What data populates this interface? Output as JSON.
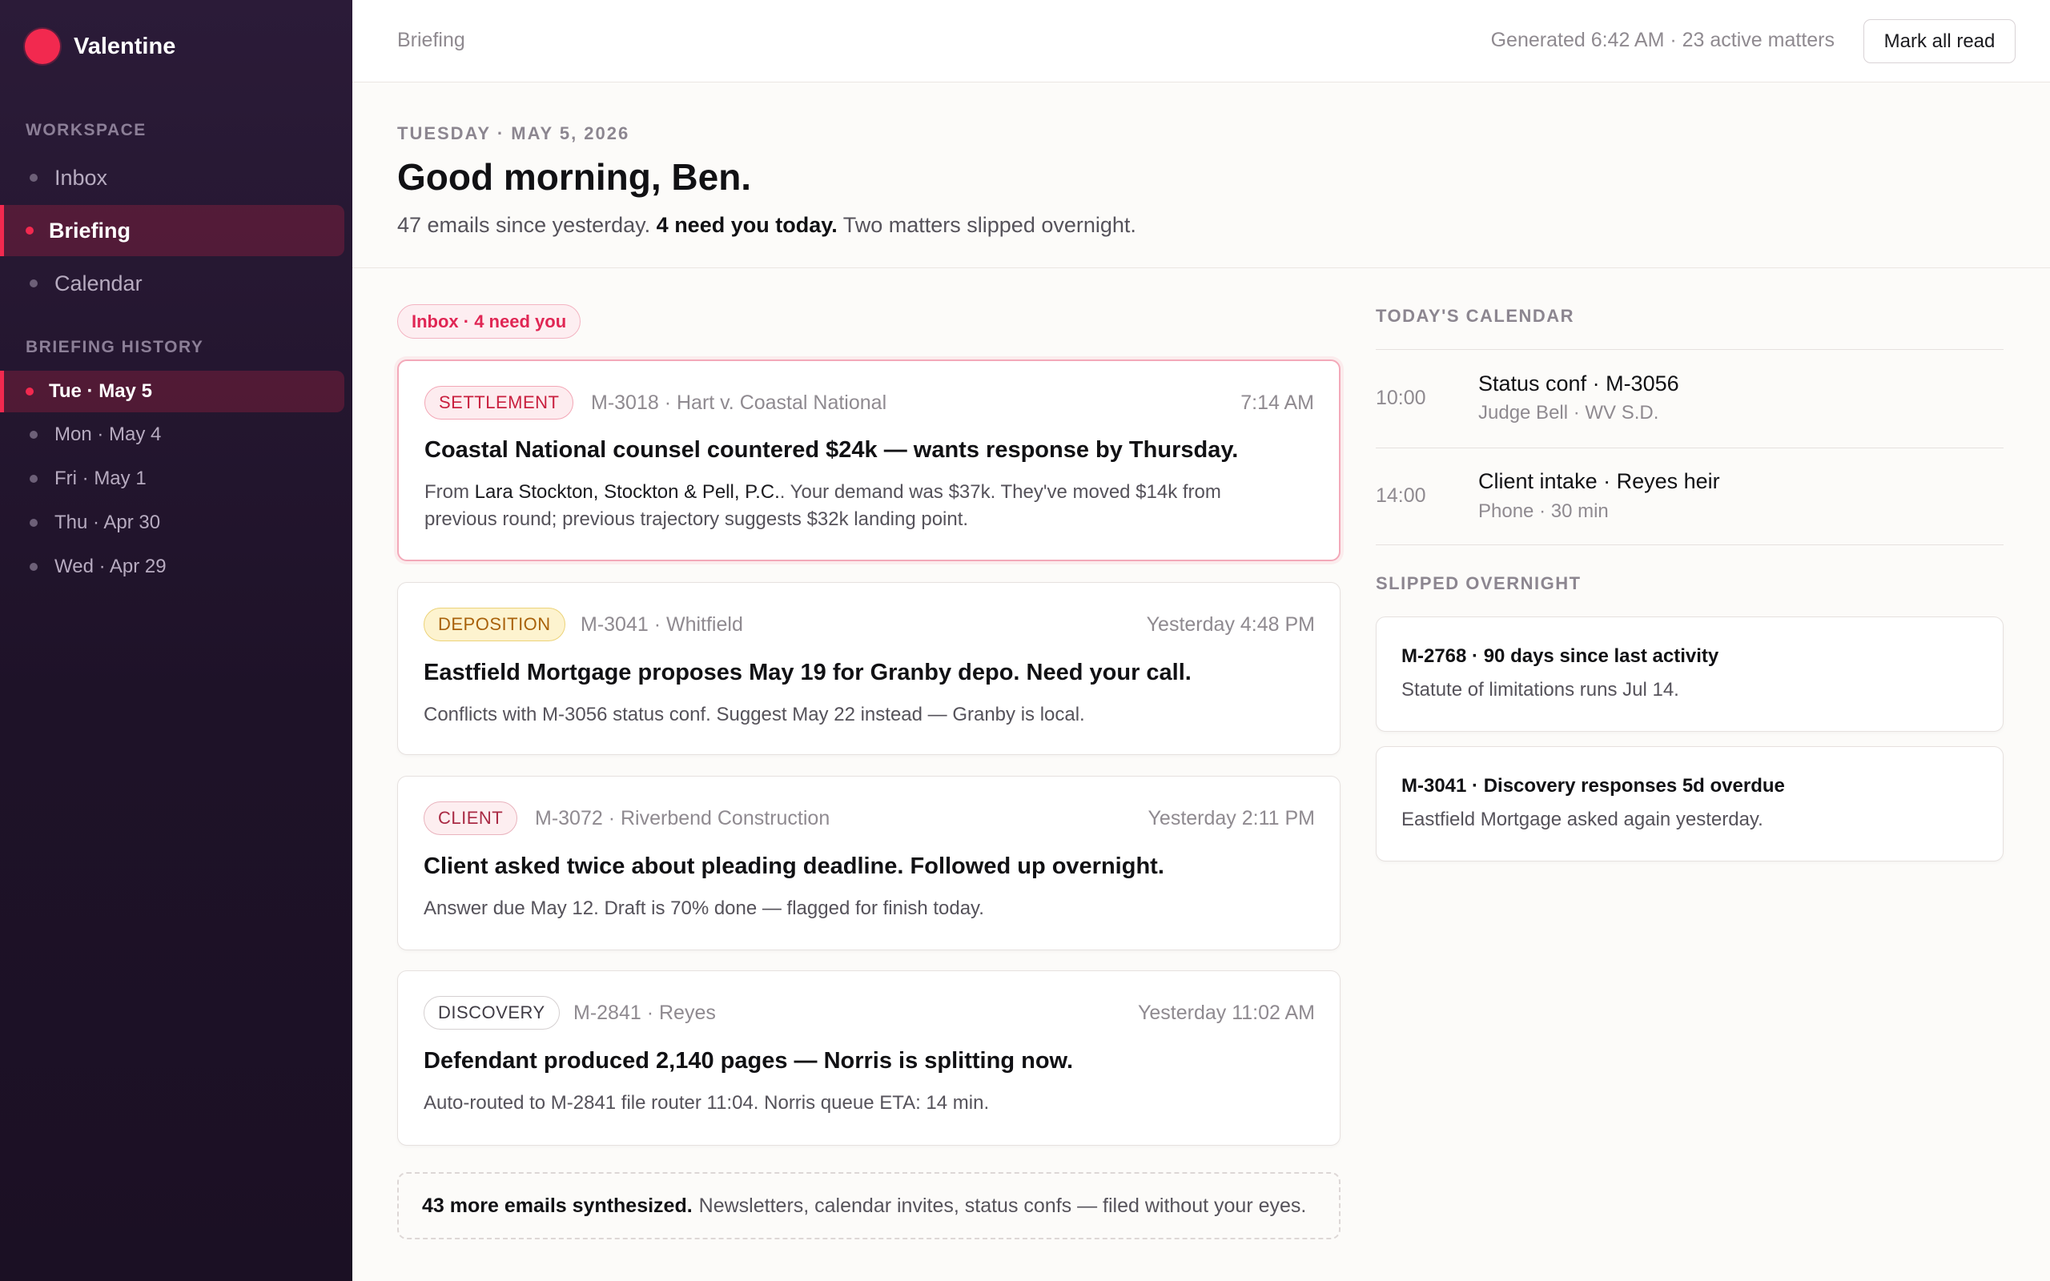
{
  "app": {
    "name": "Valentine"
  },
  "sidebar": {
    "workspace_label": "WORKSPACE",
    "workspace_items": [
      {
        "label": "Inbox",
        "active": false
      },
      {
        "label": "Briefing",
        "active": true
      },
      {
        "label": "Calendar",
        "active": false
      }
    ],
    "history_label": "BRIEFING HISTORY",
    "history_items": [
      {
        "label": "Tue · May 5",
        "active": true
      },
      {
        "label": "Mon · May 4",
        "active": false
      },
      {
        "label": "Fri · May 1",
        "active": false
      },
      {
        "label": "Thu · Apr 30",
        "active": false
      },
      {
        "label": "Wed · Apr 29",
        "active": false
      }
    ]
  },
  "topbar": {
    "breadcrumb": "Briefing",
    "generated": "Generated 6:42 AM · 23 active matters",
    "mark_all_read": "Mark all read"
  },
  "header": {
    "date": "TUESDAY · MAY 5, 2026",
    "greeting": "Good morning, Ben.",
    "summary_before": "47 emails since yesterday.",
    "summary_bold": "4 need you today.",
    "summary_after": "Two matters slipped overnight."
  },
  "inbox": {
    "pill": "Inbox · 4 need you",
    "cards": [
      {
        "tag": "SETTLEMENT",
        "matter": "M-3018 · Hart v. Coastal National",
        "time": "7:14 AM",
        "title": "Coastal National counsel countered $24k — wants response by Thursday.",
        "body_prefix": "From",
        "from_name": "Lara Stockton, Stockton & Pell, P.C.",
        "body": ". Your demand was $37k. They've moved $14k from previous round; previous trajectory suggests $32k landing point."
      },
      {
        "tag": "DEPOSITION",
        "matter": "M-3041 · Whitfield",
        "time": "Yesterday 4:48 PM",
        "title": "Eastfield Mortgage proposes May 19 for Granby depo. Need your call.",
        "body": "Conflicts with M-3056 status conf. Suggest May 22 instead — Granby is local."
      },
      {
        "tag": "CLIENT",
        "matter": "M-3072 · Riverbend Construction",
        "time": "Yesterday 2:11 PM",
        "title": "Client asked twice about pleading deadline. Followed up overnight.",
        "body": "Answer due May 12. Draft is 70% done — flagged for finish today."
      },
      {
        "tag": "DISCOVERY",
        "matter": "M-2841 · Reyes",
        "time": "Yesterday 11:02 AM",
        "title": "Defendant produced 2,140 pages — Norris is splitting now.",
        "body": "Auto-routed to M-2841 file router 11:04. Norris queue ETA: 14 min."
      }
    ],
    "more_bold": "43 more emails synthesized.",
    "more_text": "Newsletters, calendar invites, status confs — filed without your eyes."
  },
  "calendar": {
    "label": "TODAY'S CALENDAR",
    "events": [
      {
        "time": "10:00",
        "title": "Status conf · M-3056",
        "sub": "Judge Bell · WV S.D."
      },
      {
        "time": "14:00",
        "title": "Client intake · Reyes heir",
        "sub": "Phone · 30 min"
      }
    ]
  },
  "slipped": {
    "label": "SLIPPED OVERNIGHT",
    "items": [
      {
        "title": "M-2768 · 90 days since last activity",
        "body": "Statute of limitations runs Jul 14."
      },
      {
        "title": "M-3041 · Discovery responses 5d overdue",
        "body": "Eastfield Mortgage asked again yesterday."
      }
    ]
  },
  "colors": {
    "accent": "#f2294f",
    "sidebar_bg": "#241630",
    "settlement": "#c9203f",
    "deposition": "#a9620b"
  }
}
